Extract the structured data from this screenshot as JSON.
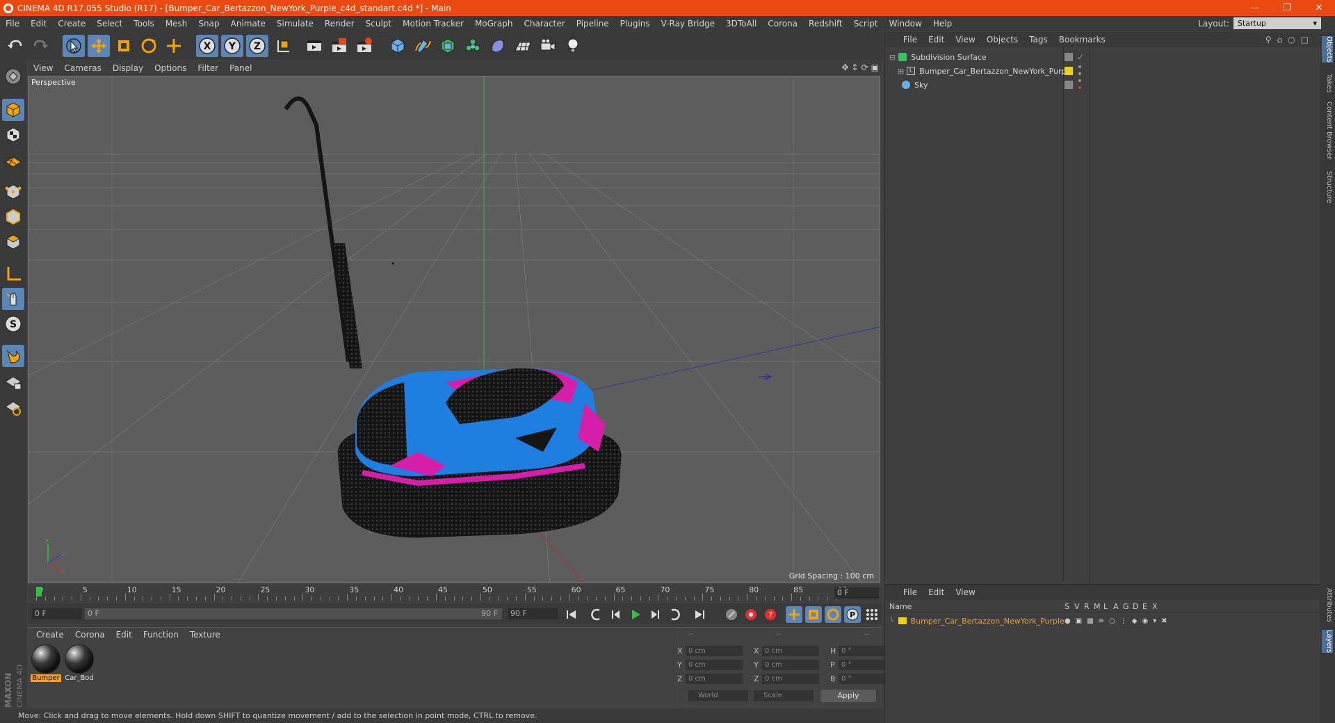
{
  "window": {
    "title": "CINEMA 4D R17.055 Studio (R17) - [Bumper_Car_Bertazzon_NewYork_Purple_c4d_standart.c4d *] - Main"
  },
  "menu": [
    "File",
    "Edit",
    "Create",
    "Select",
    "Tools",
    "Mesh",
    "Snap",
    "Animate",
    "Simulate",
    "Render",
    "Sculpt",
    "Motion Tracker",
    "MoGraph",
    "Character",
    "Pipeline",
    "Plugins",
    "V-Ray Bridge",
    "3DToAll",
    "Corona",
    "Redshift",
    "Script",
    "Window",
    "Help"
  ],
  "layout": {
    "label": "Layout:",
    "value": "Startup"
  },
  "viewport": {
    "menu": [
      "View",
      "Cameras",
      "Display",
      "Options",
      "Filter",
      "Panel"
    ],
    "label": "Perspective",
    "grid_spacing": "Grid Spacing : 100 cm"
  },
  "timeline": {
    "ticks": [
      "0",
      "5",
      "10",
      "15",
      "20",
      "25",
      "30",
      "35",
      "40",
      "45",
      "50",
      "55",
      "60",
      "65",
      "70",
      "75",
      "80",
      "85",
      "90"
    ],
    "current_frame": "0 F"
  },
  "transport": {
    "start": "0 F",
    "range_start": "0 F",
    "range_end": "90 F",
    "end": "90 F"
  },
  "materials": {
    "menu": [
      "Create",
      "Corona",
      "Edit",
      "Function",
      "Texture"
    ],
    "items": [
      {
        "label": "Bumper",
        "selected": true
      },
      {
        "label": "Car_Bod",
        "selected": false
      }
    ]
  },
  "coords": {
    "header": [
      "--",
      "--",
      "--"
    ],
    "rows": [
      {
        "l1": "X",
        "v1": "0 cm",
        "l2": "X",
        "v2": "0 cm",
        "l3": "H",
        "v3": "0 °"
      },
      {
        "l1": "Y",
        "v1": "0 cm",
        "l2": "Y",
        "v2": "0 cm",
        "l3": "P",
        "v3": "0 °"
      },
      {
        "l1": "Z",
        "v1": "0 cm",
        "l2": "Z",
        "v2": "0 cm",
        "l3": "B",
        "v3": "0 °"
      }
    ],
    "mode": "World",
    "kind": "Scale",
    "apply": "Apply"
  },
  "status": "Move: Click and drag to move elements. Hold down SHIFT to quantize movement / add to the selection in point mode, CTRL to remove.",
  "objects": {
    "menu": [
      "File",
      "Edit",
      "View",
      "Objects",
      "Tags",
      "Bookmarks"
    ],
    "items": [
      {
        "name": "Subdivision Surface"
      },
      {
        "name": "Bumper_Car_Bertazzon_NewYork_Purple"
      },
      {
        "name": "Sky"
      }
    ]
  },
  "layers": {
    "menu": [
      "File",
      "Edit",
      "View"
    ],
    "columns": [
      "Name",
      "S",
      "V",
      "R",
      "M",
      "L",
      "A",
      "G",
      "D",
      "E",
      "X"
    ],
    "items": [
      {
        "name": "Bumper_Car_Bertazzon_NewYork_Purple"
      }
    ]
  },
  "side_tabs": [
    "Objects",
    "Takes",
    "Content Browser",
    "Structure",
    "Attributes",
    "Layers"
  ],
  "brand": {
    "line1": "MAXON",
    "line2": "CINEMA 4D"
  },
  "colors": {
    "titlebar": "#ea4a12",
    "active_tool": "#5a86b8",
    "layer_yellow": "#e8d21a",
    "selected_material": "#f0a030",
    "layer_name_orange": "#f0a030"
  }
}
